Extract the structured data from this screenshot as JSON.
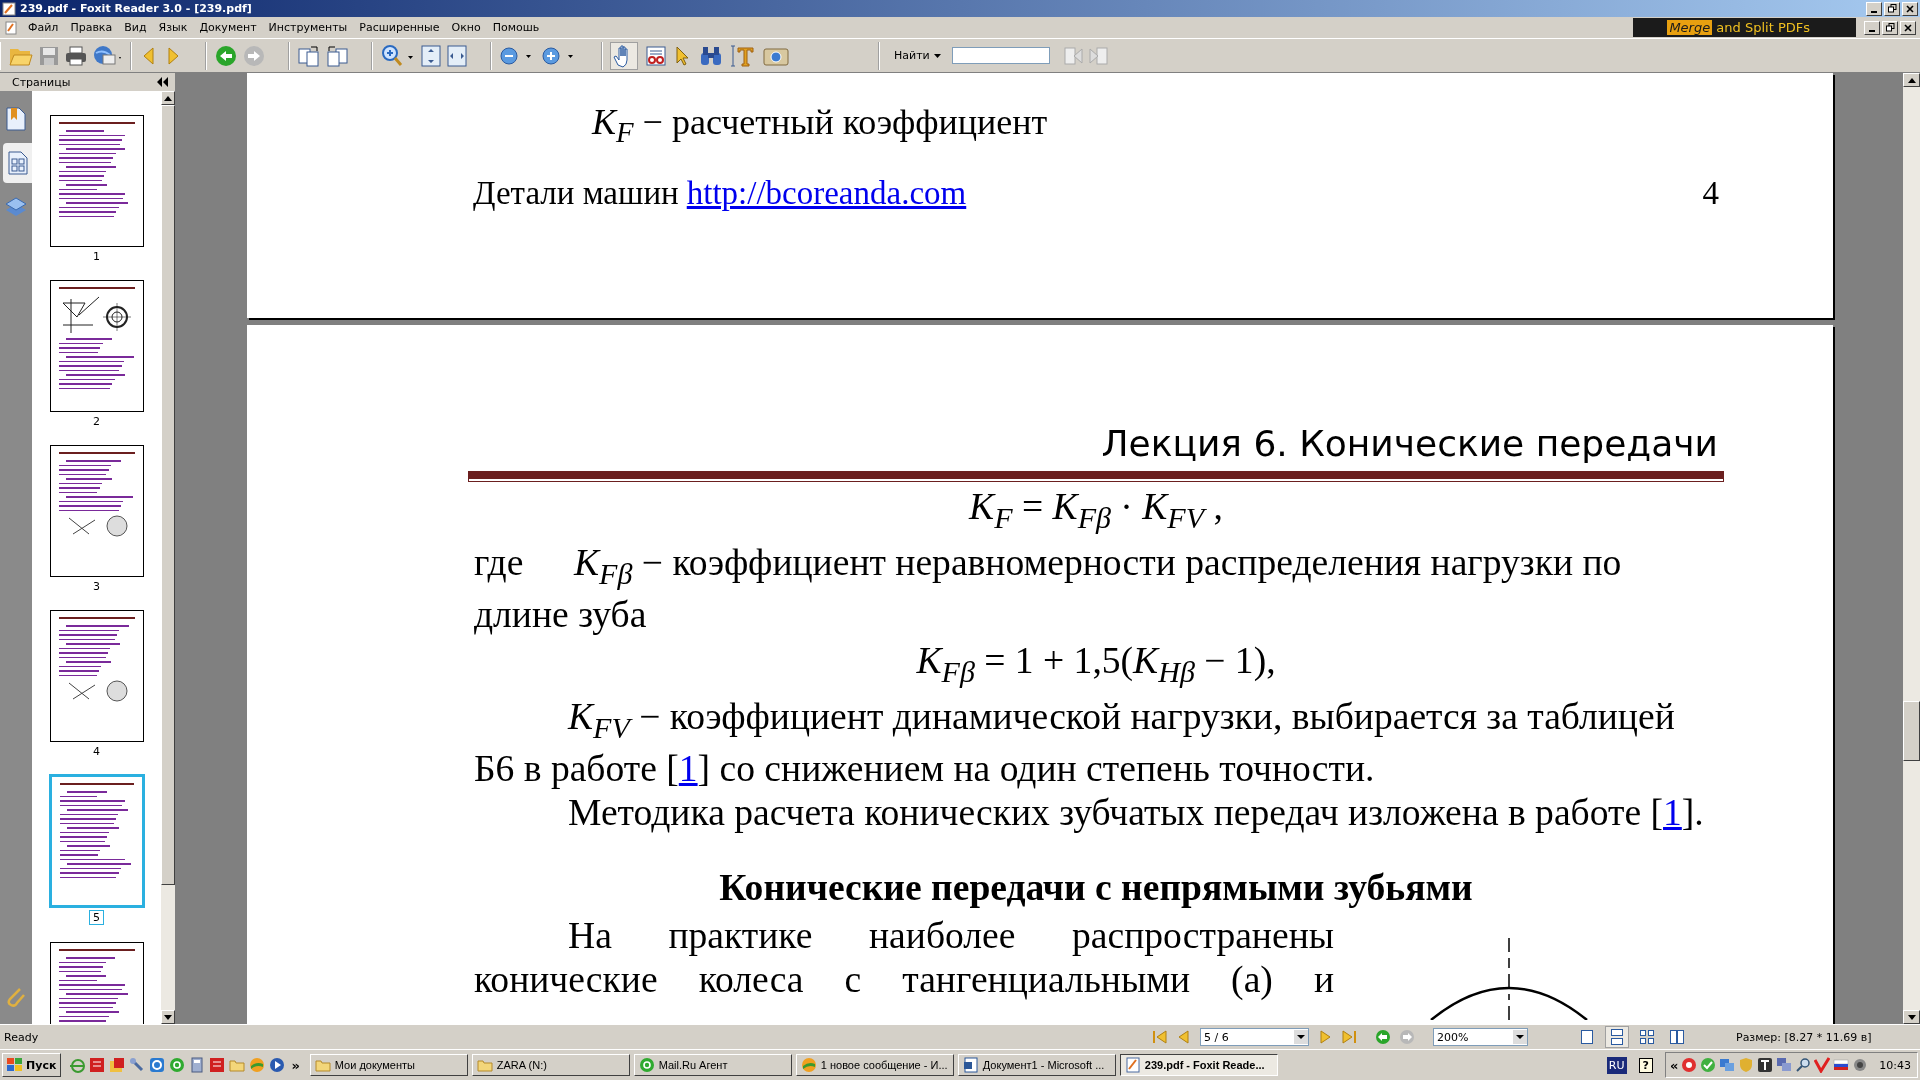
{
  "window": {
    "title": "239.pdf - Foxit Reader 3.0 - [239.pdf]"
  },
  "menu": [
    "Файл",
    "Правка",
    "Вид",
    "Язык",
    "Документ",
    "Инструменты",
    "Расширенные",
    "Окно",
    "Помошь"
  ],
  "ad": {
    "brand": "Merge",
    "text": "and Split PDFs"
  },
  "find": {
    "label": "Найти"
  },
  "sidebar": {
    "title": "Страницы",
    "tabs": [
      {
        "kind": "bookmarks",
        "selected": false
      },
      {
        "kind": "pages",
        "selected": true
      },
      {
        "kind": "layers",
        "selected": false
      }
    ],
    "thumbnails": [
      {
        "label": "1",
        "kind": "text",
        "selected": false
      },
      {
        "label": "2",
        "kind": "diagram",
        "selected": false
      },
      {
        "label": "3",
        "kind": "figure",
        "selected": false
      },
      {
        "label": "4",
        "kind": "figure",
        "selected": false
      },
      {
        "label": "5",
        "kind": "text",
        "selected": true
      },
      {
        "kind": "text",
        "selected": false
      }
    ]
  },
  "page_4": {
    "symbol": "*K*$_{F}$",
    "text": "− расчетный коэффициент",
    "footer_text": "Детали машин",
    "footer_link": "http://bcoreanda.com",
    "page_number": "4"
  },
  "page_5": {
    "header": "Лекция 6. Конические передачи",
    "blocks": [
      {
        "kind": "formula",
        "text": "*K*$_{F}$ = *K*$_{Fβ}$ · *K*$_{FV}$ ,"
      },
      {
        "kind": "paragraph",
        "indent": false,
        "parts": [
          {
            "kind": "lead",
            "text": "где"
          },
          {
            "kind": "symbol",
            "text": "*K*$_{Fβ}$"
          },
          {
            "kind": "text",
            "text": " − коэффициент неравномерности распределения нагрузки по длине зуба"
          }
        ]
      },
      {
        "kind": "formula",
        "text": "*K*$_{Fβ}$ = 1 + 1,5(*K*$_{Hβ}$ − 1),"
      },
      {
        "kind": "paragraph",
        "indent": true,
        "parts": [
          {
            "kind": "symbol",
            "text": "*K*$_{FV}$"
          },
          {
            "kind": "text",
            "text": " − коэффициент динамической нагрузки, выбирается за таблицей Б6 в работе ["
          },
          {
            "kind": "link",
            "text": "1"
          },
          {
            "kind": "text",
            "text": "]  со снижением на один степень точности."
          }
        ]
      },
      {
        "kind": "paragraph",
        "indent": true,
        "parts": [
          {
            "kind": "text",
            "text": "Методика расчета конических зубчатых передач изложена в работе ["
          },
          {
            "kind": "link",
            "text": "1"
          },
          {
            "kind": "text",
            "text": "]."
          }
        ]
      },
      {
        "kind": "heading",
        "text": "Конические передачи с непрямыми зубьями"
      },
      {
        "kind": "figure_paragraph",
        "indent": true,
        "text": "На практике наиболее распространены конические колеса с тангенциальными (а) и"
      }
    ]
  },
  "status_bar": {
    "text": "Ready",
    "page_field": "5 / 6",
    "zoom_field": "200%",
    "view_modes": [
      {
        "kind": "single",
        "selected": false
      },
      {
        "kind": "continuous",
        "selected": true
      },
      {
        "kind": "grid",
        "selected": false
      },
      {
        "kind": "facing",
        "selected": false
      }
    ],
    "size": "Размер: [8.27 * 11.69 в]"
  },
  "taskbar": {
    "start": "Пуск",
    "more": "»",
    "tasks": [
      {
        "label": "Мои документы",
        "kind": "folder",
        "selected": false
      },
      {
        "label": "ZARA (N:)",
        "kind": "folder",
        "selected": false
      },
      {
        "label": "Mail.Ru Агент",
        "kind": "agent",
        "selected": false
      },
      {
        "label": "1 новое сообщение - И...",
        "kind": "chat",
        "selected": false
      },
      {
        "label": "Документ1 - Microsoft ...",
        "kind": "word",
        "selected": false
      },
      {
        "label": "239.pdf - Foxit Reade...",
        "kind": "pdf",
        "selected": true
      }
    ],
    "lang": "RU",
    "help": "?",
    "expand": "«",
    "time": "10:43"
  }
}
